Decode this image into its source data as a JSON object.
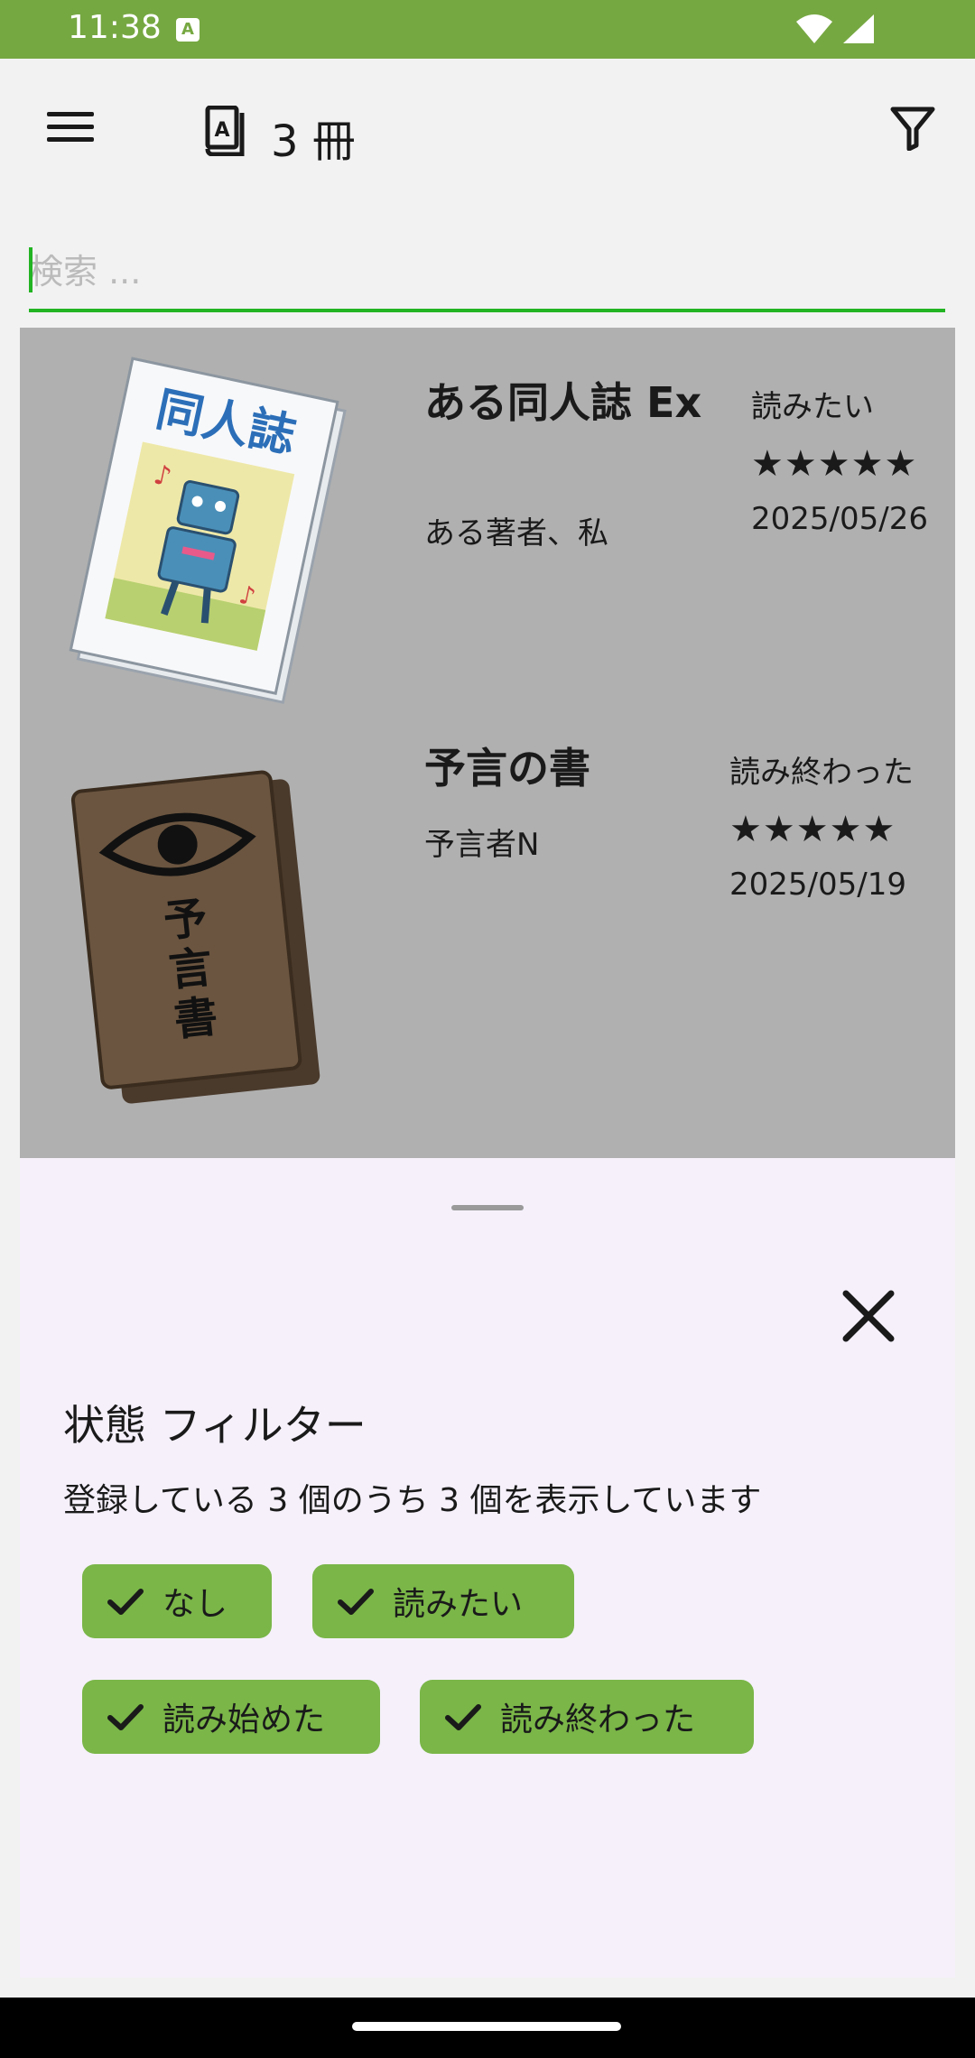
{
  "status_bar": {
    "time": "11:38",
    "notification_icon": "A"
  },
  "app_bar": {
    "book_count": "3 冊"
  },
  "search": {
    "placeholder": "検索 ..."
  },
  "books": [
    {
      "title": "ある同人誌 Ex",
      "author": "ある著者、私",
      "status": "読みたい",
      "stars": "★★★★★",
      "date": "2025/05/26"
    },
    {
      "title": "予言の書",
      "author": "予言者N",
      "status": "読み終わった",
      "stars": "★★★★★",
      "date": "2025/05/19"
    }
  ],
  "filter_sheet": {
    "title": "状態 フィルター",
    "description": "登録している 3 個のうち 3 個を表示しています",
    "chips": [
      "なし",
      "読みたい",
      "読み始めた",
      "読み終わった"
    ]
  },
  "colors": {
    "status_bar": "#76a842",
    "chip": "#7ab648",
    "accent": "#22b422",
    "scrim": "#b0b0b0",
    "sheet": "#f5f0fa"
  }
}
